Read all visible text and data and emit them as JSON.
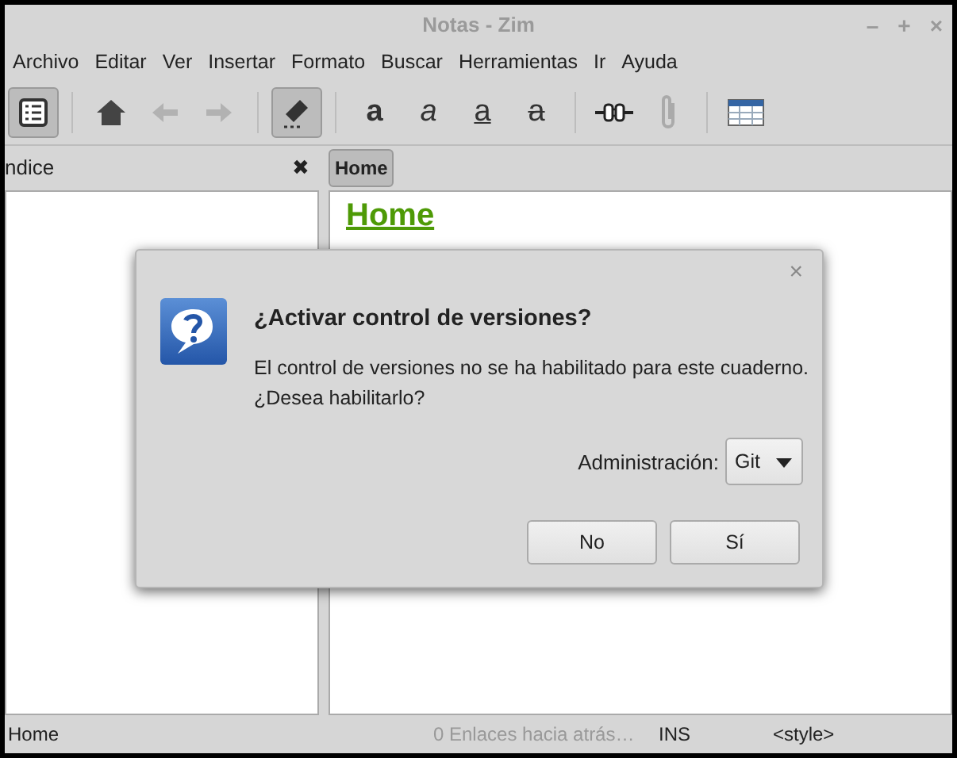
{
  "window": {
    "title": "Notas - Zim",
    "controls": [
      "–",
      "+",
      "×"
    ]
  },
  "menu": [
    "Archivo",
    "Editar",
    "Ver",
    "Insertar",
    "Formato",
    "Buscar",
    "Herramientas",
    "Ir",
    "Ayuda"
  ],
  "toolbar": [
    {
      "kind": "index",
      "selected": true,
      "disabled": false
    },
    {
      "kind": "sep"
    },
    {
      "kind": "home",
      "selected": false,
      "disabled": false
    },
    {
      "kind": "back",
      "selected": false,
      "disabled": true
    },
    {
      "kind": "forward",
      "selected": false,
      "disabled": true
    },
    {
      "kind": "sep"
    },
    {
      "kind": "edit",
      "selected": true,
      "disabled": false
    },
    {
      "kind": "sep"
    },
    {
      "kind": "bold",
      "label": "a",
      "selected": false,
      "disabled": false
    },
    {
      "kind": "italic",
      "label": "a",
      "selected": false,
      "disabled": false
    },
    {
      "kind": "underline",
      "label": "a",
      "selected": false,
      "disabled": false
    },
    {
      "kind": "strike",
      "label": "a",
      "selected": false,
      "disabled": false
    },
    {
      "kind": "sep"
    },
    {
      "kind": "link",
      "selected": false,
      "disabled": false
    },
    {
      "kind": "attach",
      "selected": false,
      "disabled": true
    },
    {
      "kind": "sep"
    },
    {
      "kind": "table",
      "selected": false,
      "disabled": false
    }
  ],
  "side_panel": {
    "title": "ndice",
    "close": "✖"
  },
  "tabs": [
    {
      "label": "Home",
      "selected": true
    }
  ],
  "page": {
    "heading": "Home"
  },
  "dialog": {
    "close": "×",
    "title": "¿Activar control de versiones?",
    "message": [
      "El control de versiones no se ha habilitado para este cuaderno.",
      "¿Desea habilitarlo?"
    ],
    "field_label": "Administración:",
    "dropdown": "Git",
    "buttons": [
      "No",
      "Sí"
    ]
  },
  "status_bar": {
    "page": "Home",
    "backlinks": "0 Enlaces hacia atrás…",
    "mode": "INS",
    "style": "<style>"
  }
}
